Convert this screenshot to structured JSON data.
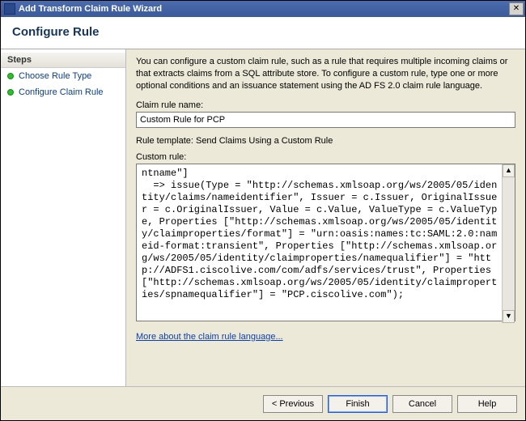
{
  "window": {
    "title": "Add Transform Claim Rule Wizard",
    "close_glyph": "✕"
  },
  "header": {
    "title": "Configure Rule"
  },
  "sidebar": {
    "steps_label": "Steps",
    "items": [
      {
        "label": "Choose Rule Type"
      },
      {
        "label": "Configure Claim Rule"
      }
    ]
  },
  "main": {
    "description": "You can configure a custom claim rule, such as a rule that requires multiple incoming claims or that extracts claims from a SQL attribute store. To configure a custom rule, type one or more optional conditions and an issuance statement using the AD FS 2.0 claim rule language.",
    "name_label": "Claim rule name:",
    "name_value": "Custom Rule for PCP",
    "template_line": "Rule template: Send Claims Using a Custom Rule",
    "custom_label": "Custom rule:",
    "custom_rule": "ntname\"]\n  => issue(Type = \"http://schemas.xmlsoap.org/ws/2005/05/identity/claims/nameidentifier\", Issuer = c.Issuer, OriginalIssuer = c.OriginalIssuer, Value = c.Value, ValueType = c.ValueType, Properties [\"http://schemas.xmlsoap.org/ws/2005/05/identity/claimproperties/format\"] = \"urn:oasis:names:tc:SAML:2.0:nameid-format:transient\", Properties [\"http://schemas.xmlsoap.org/ws/2005/05/identity/claimproperties/namequalifier\"] = \"http://ADFS1.ciscolive.com/com/adfs/services/trust\", Properties [\"http://schemas.xmlsoap.org/ws/2005/05/identity/claimproperties/spnamequalifier\"] = \"PCP.ciscolive.com\");",
    "link_text": "More about the claim rule language..."
  },
  "footer": {
    "previous": "< Previous",
    "finish": "Finish",
    "cancel": "Cancel",
    "help": "Help"
  },
  "scroll": {
    "up": "▲",
    "down": "▼"
  }
}
